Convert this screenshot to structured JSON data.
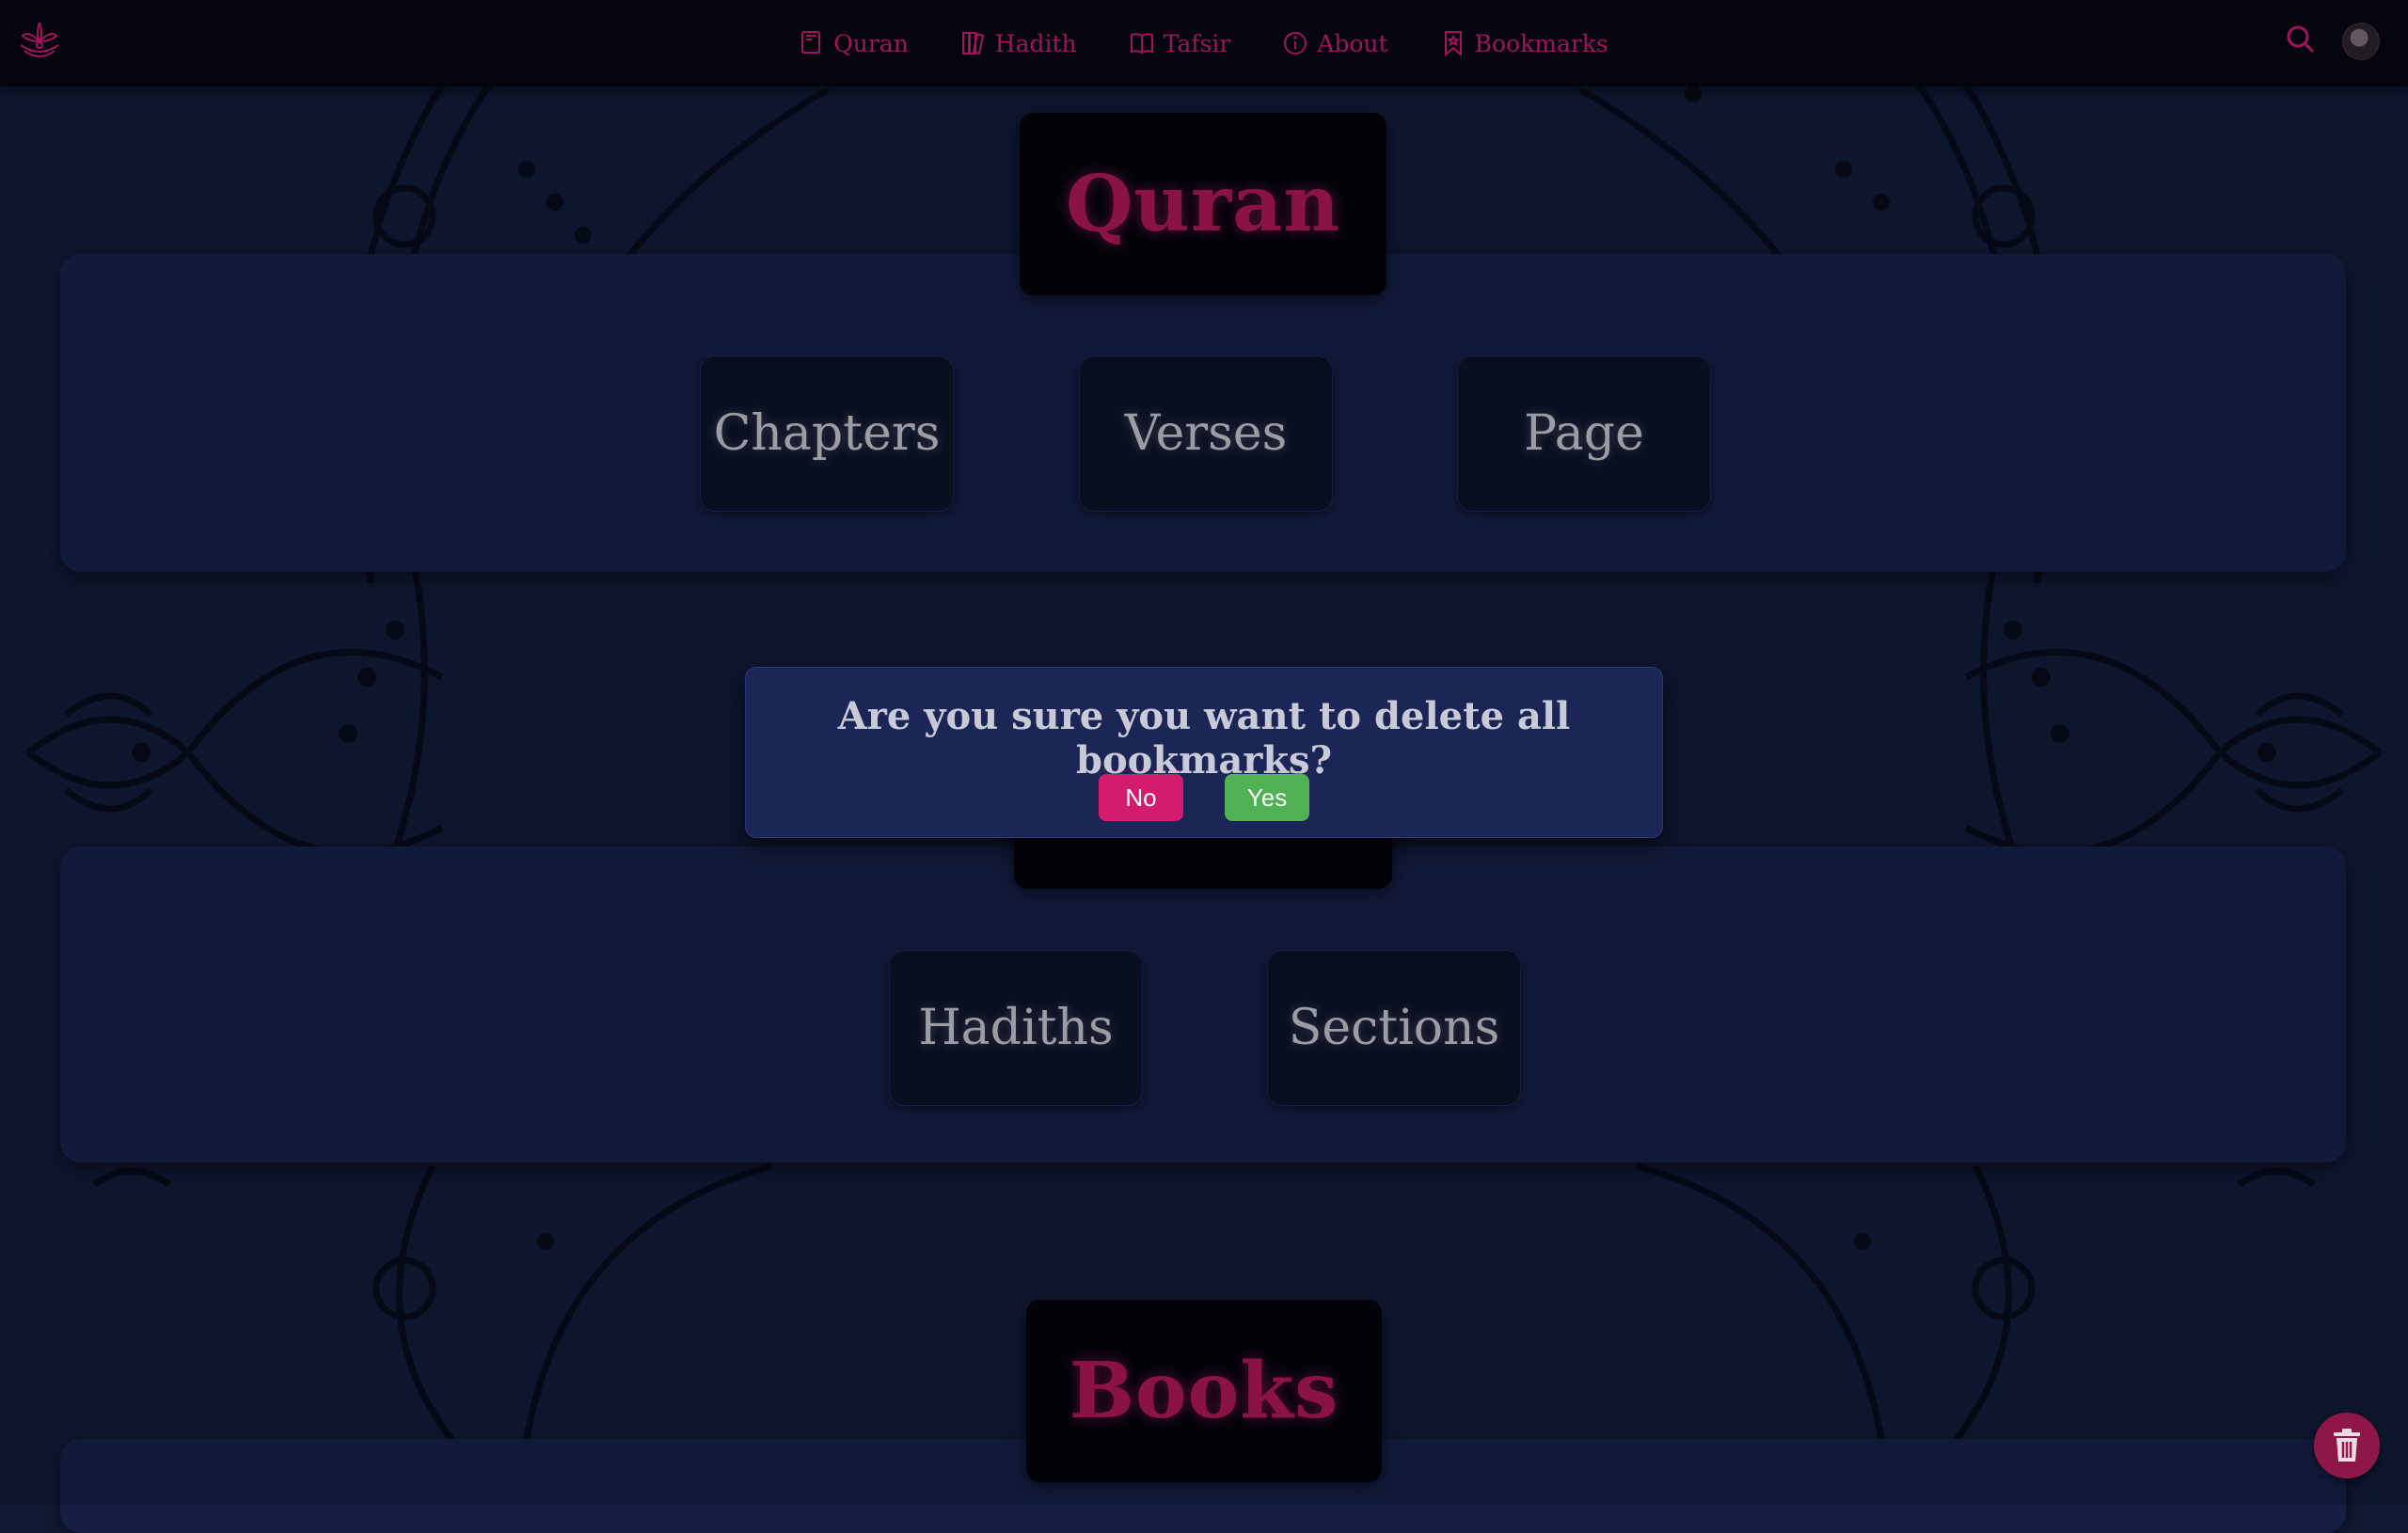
{
  "nav": {
    "items": [
      {
        "label": "Quran",
        "icon": "quran-book-icon"
      },
      {
        "label": "Hadith",
        "icon": "books-icon"
      },
      {
        "label": "Tafsir",
        "icon": "open-book-icon"
      },
      {
        "label": "About",
        "icon": "info-icon"
      },
      {
        "label": "Bookmarks",
        "icon": "bookmark-icon"
      }
    ]
  },
  "sections": {
    "quran": {
      "title": "Quran",
      "buttons": [
        "Chapters",
        "Verses",
        "Page"
      ]
    },
    "hadith": {
      "buttons": [
        "Hadiths",
        "Sections"
      ]
    },
    "books": {
      "title": "Books"
    }
  },
  "dialog": {
    "message": "Are you sure you want to delete all bookmarks?",
    "no_label": "No",
    "yes_label": "Yes"
  },
  "colors": {
    "accent": "#c4186b",
    "background": "#111a33",
    "panel": "#151f42",
    "dialog": "#1b2657",
    "no_button": "#d41c6f",
    "yes_button": "#4fb152"
  }
}
